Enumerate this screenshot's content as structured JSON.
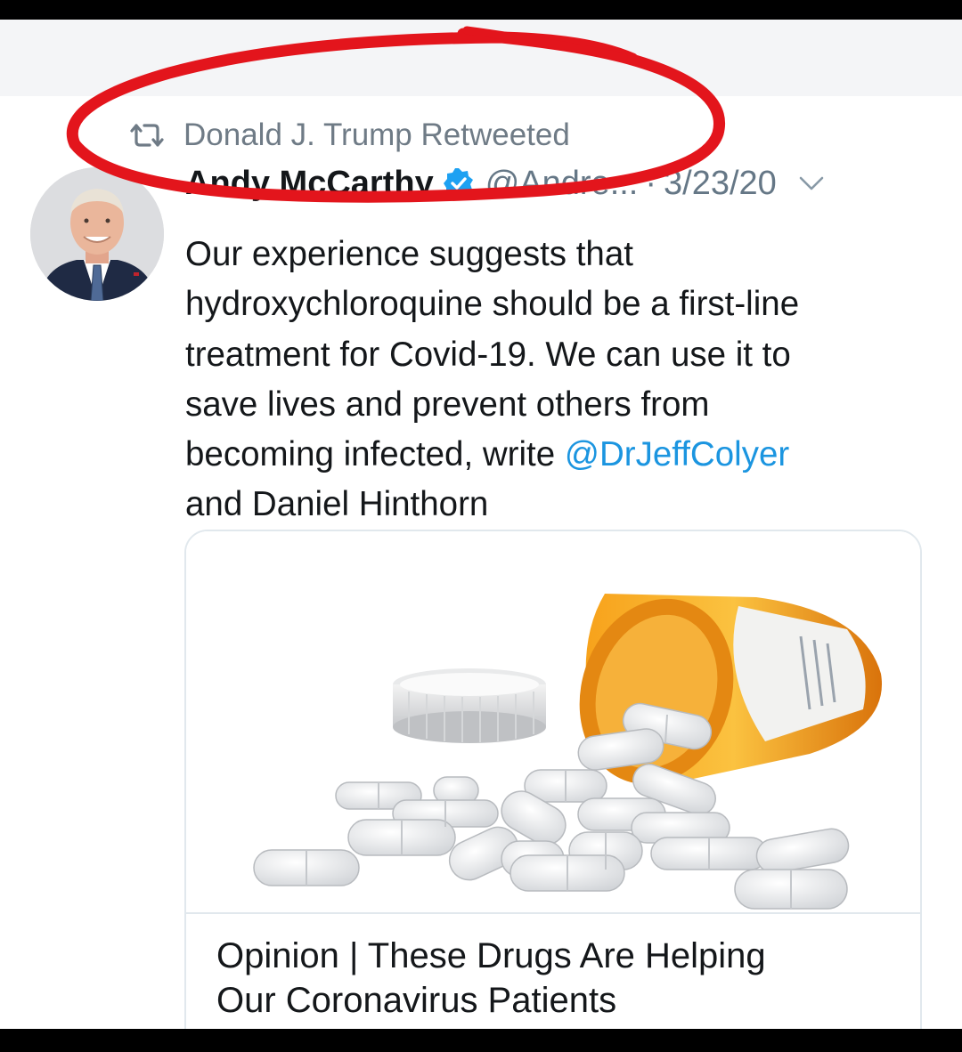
{
  "retweet_banner": {
    "icon": "retweet-icon",
    "text": "Donald J. Trump Retweeted"
  },
  "tweet": {
    "author_name": "Andy McCarthy",
    "verified_icon": "verified-badge-icon",
    "handle": "@Andre...",
    "separator": "·",
    "date": "3/23/20",
    "menu_icon": "chevron-down-icon",
    "text_lines": [
      "Our experience suggests that",
      "hydroxychloroquine should be a first-line",
      "treatment for Covid-19. We can use it to",
      "save lives and prevent others from"
    ],
    "line5_prefix": "becoming infected, write ",
    "mention": "@DrJeffColyer",
    "line6": "and Daniel Hinthorn"
  },
  "card": {
    "image": "pill-bottle-with-spilled-pills",
    "title_line1": "Opinion | These Drugs Are Helping",
    "title_line2": "Our Coronavirus Patients"
  },
  "annotation": {
    "type": "hand-drawn-red-ellipse",
    "color": "#e3151c"
  },
  "colors": {
    "mention": "#1b95e0",
    "secondary_text": "#657786",
    "verified": "#1da1f2"
  }
}
